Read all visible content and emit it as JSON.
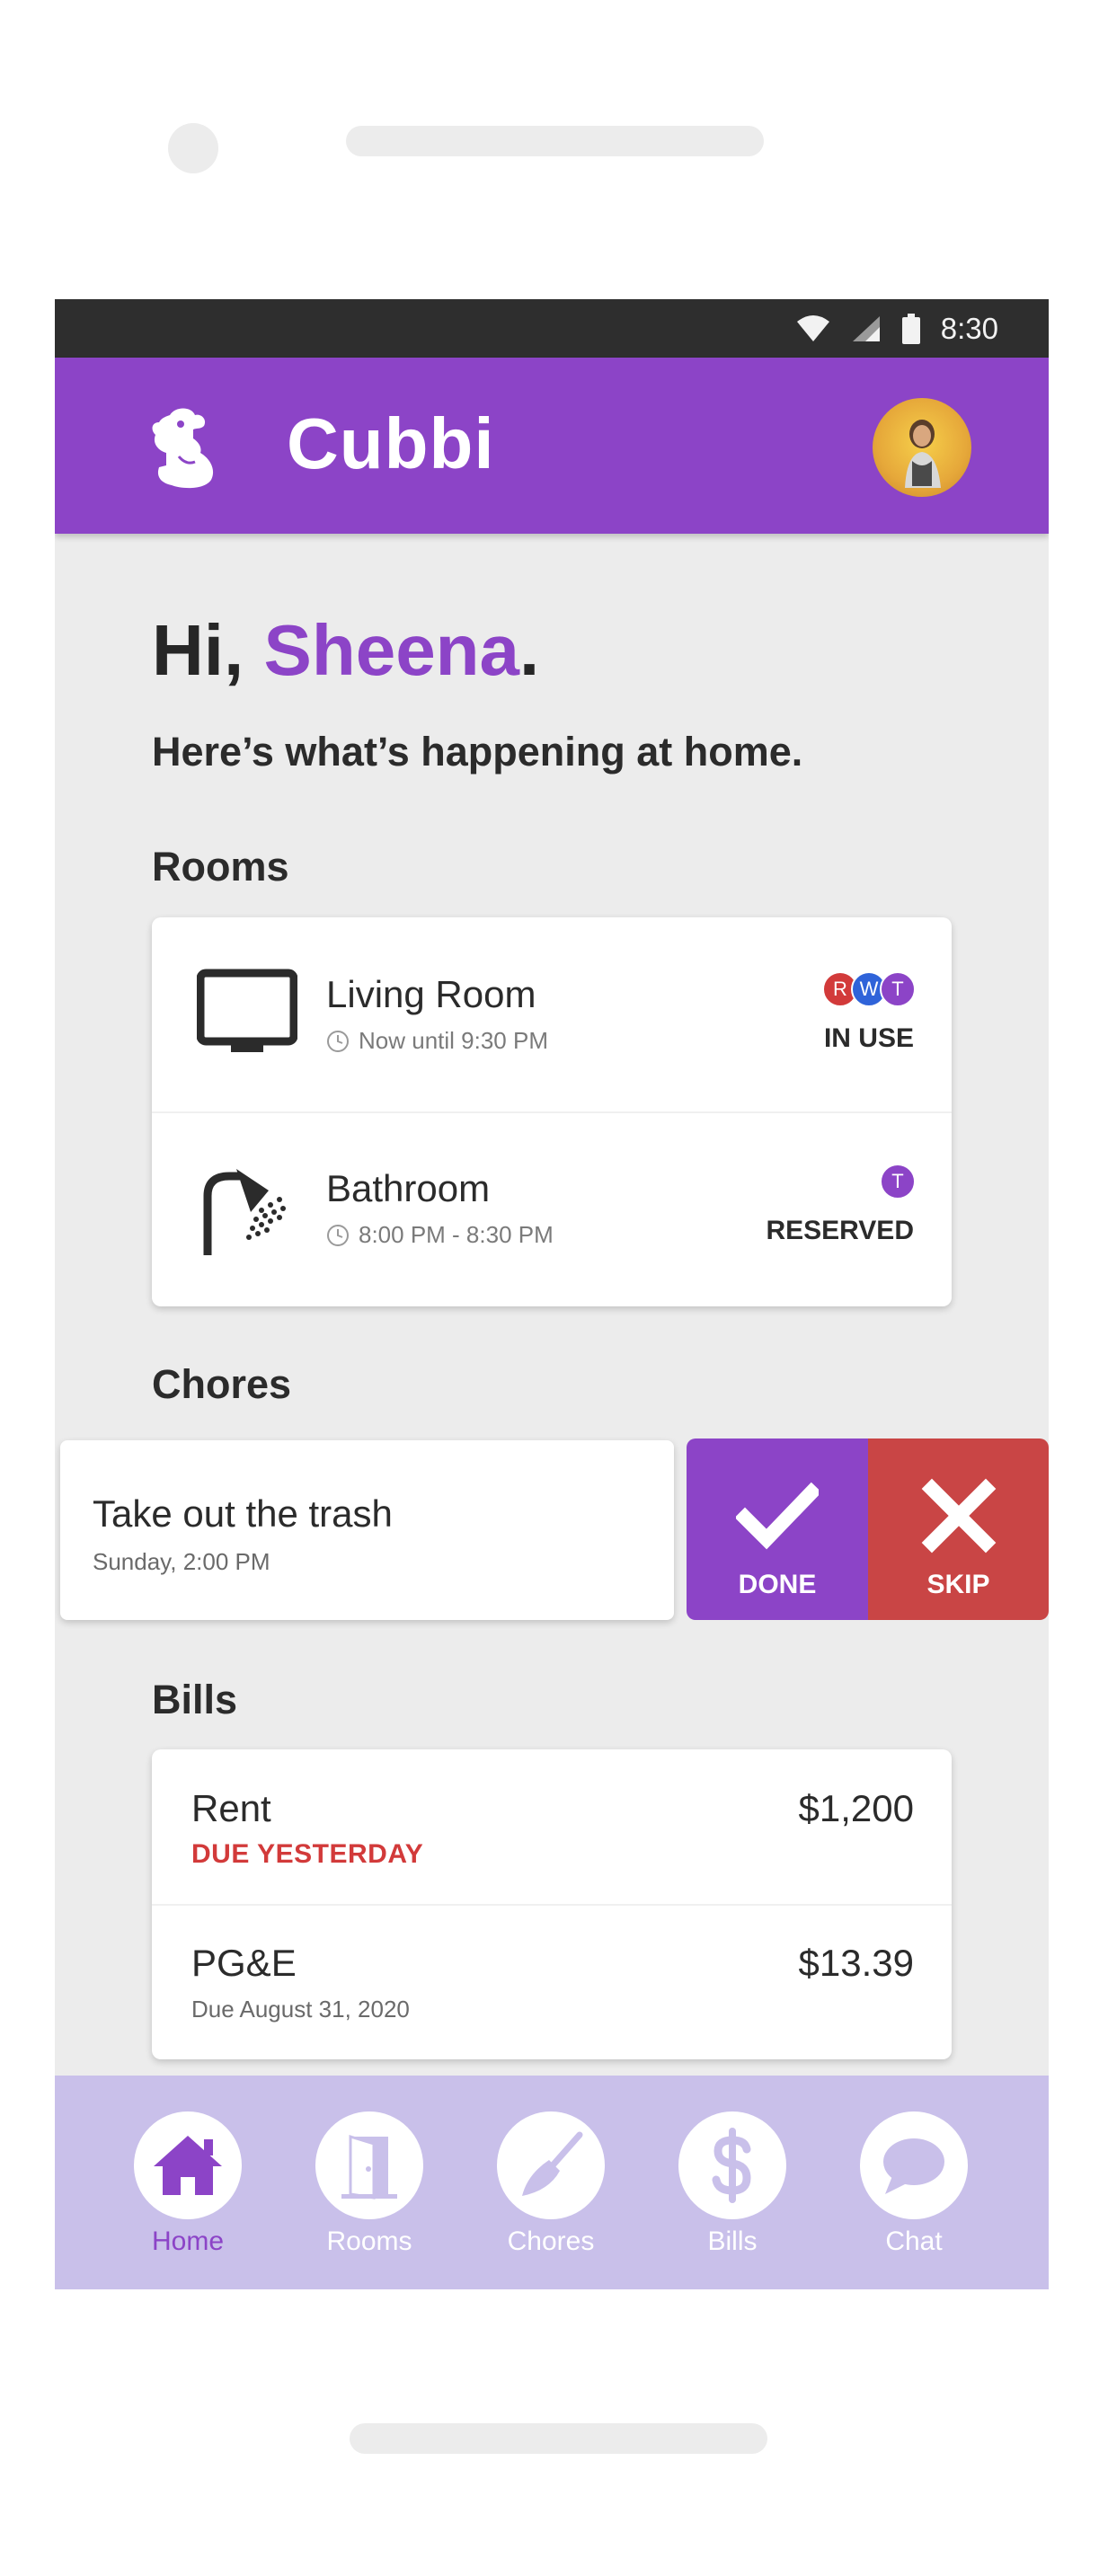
{
  "status_bar": {
    "time": "8:30"
  },
  "app": {
    "title": "Cubbi"
  },
  "greeting": {
    "hi": "Hi,",
    "name": "Sheena",
    "punct": ".",
    "subtitle": "Here’s what’s happening at home."
  },
  "rooms": {
    "heading": "Rooms",
    "items": [
      {
        "name": "Living Room",
        "time": "Now until 9:30 PM",
        "status": "IN USE",
        "occupants": [
          "R",
          "W",
          "T"
        ]
      },
      {
        "name": "Bathroom",
        "time": "8:00 PM - 8:30 PM",
        "status": "RESERVED",
        "occupants": [
          "T"
        ]
      }
    ]
  },
  "chores": {
    "heading": "Chores",
    "items": [
      {
        "title": "Take out the trash",
        "time": "Sunday, 2:00 PM"
      }
    ],
    "done_label": "DONE",
    "skip_label": "SKIP"
  },
  "bills": {
    "heading": "Bills",
    "items": [
      {
        "name": "Rent",
        "due": "DUE YESTERDAY",
        "amount": "$1,200"
      },
      {
        "name": "PG&E",
        "due": "Due August 31, 2020",
        "amount": "$13.39"
      }
    ]
  },
  "nav": {
    "items": [
      {
        "label": "Home",
        "icon": "home-icon"
      },
      {
        "label": "Rooms",
        "icon": "door-icon"
      },
      {
        "label": "Chores",
        "icon": "broom-icon"
      },
      {
        "label": "Bills",
        "icon": "dollar-icon"
      },
      {
        "label": "Chat",
        "icon": "chat-bubble-icon"
      }
    ],
    "active": "Home"
  },
  "colors": {
    "brand": "#8c44c7",
    "danger": "#c94545",
    "nav_bg": "#c9c0ea",
    "occupant_r": "#d23a3a",
    "occupant_w": "#2f63d9",
    "occupant_t": "#8c44c7"
  }
}
